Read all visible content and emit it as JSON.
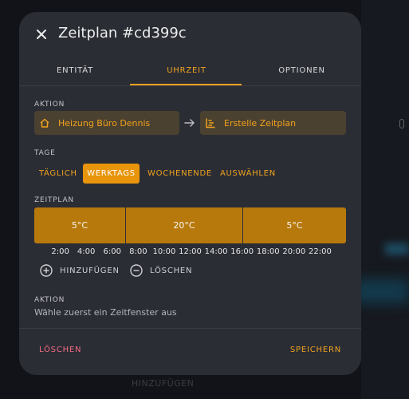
{
  "background": {
    "faded_button": "HINZUFÜGEN"
  },
  "dialog": {
    "title": "Zeitplan #cd399c",
    "tabs": [
      {
        "label": "ENTITÄT"
      },
      {
        "label": "UHRZEIT",
        "active": true
      },
      {
        "label": "OPTIONEN"
      }
    ],
    "action_section": {
      "label": "AKTION",
      "entity": {
        "label": "Heizung Büro Dennis",
        "icon": "home-icon"
      },
      "service": {
        "label": "Erstelle Zeitplan",
        "icon": "chart-timeline-icon"
      }
    },
    "days_section": {
      "label": "TAGE",
      "options": [
        "TÄGLICH",
        "WERKTAGS",
        "WOCHENENDE",
        "AUSWÄHLEN"
      ],
      "selected": "WERKTAGS"
    },
    "schedule_section": {
      "label": "ZEITPLAN",
      "segments": [
        {
          "label": "5°C",
          "start": "0:00",
          "end": "7:00"
        },
        {
          "label": "20°C",
          "start": "7:00",
          "end": "16:00"
        },
        {
          "label": "5°C",
          "start": "16:00",
          "end": "24:00"
        }
      ],
      "ticks": [
        "2:00",
        "4:00",
        "6:00",
        "8:00",
        "10:00",
        "12:00",
        "14:00",
        "16:00",
        "18:00",
        "20:00",
        "22:00"
      ],
      "add_label": "HINZUFÜGEN",
      "remove_label": "LÖSCHEN"
    },
    "action_detail": {
      "label": "AKTION",
      "hint": "Wähle zuerst ein Zeitfenster aus"
    },
    "footer": {
      "delete_label": "LÖSCHEN",
      "save_label": "SPEICHERN"
    },
    "colors": {
      "accent": "#f0a21e",
      "segment": "#b8790c",
      "danger": "#ef6a80",
      "surface": "#2b2d35"
    }
  }
}
